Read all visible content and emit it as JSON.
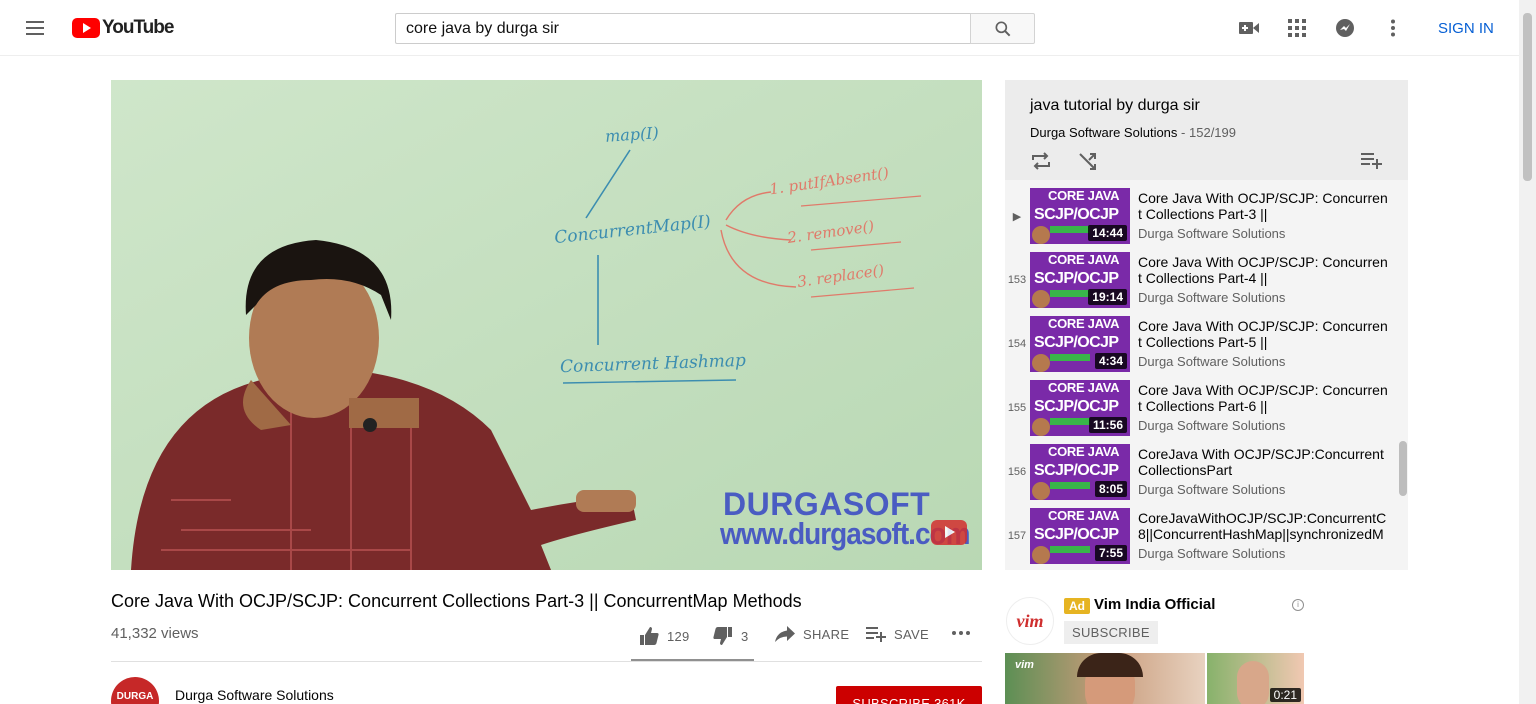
{
  "header": {
    "logo_text": "YouTube",
    "search_value": "core java by durga sir",
    "sign_in": "SIGN IN"
  },
  "video": {
    "title": "Core Java With OCJP/SCJP: Concurrent Collections Part-3 || ConcurrentMap Methods",
    "views": "41,332 views",
    "likes": "129",
    "dislikes": "3",
    "share": "SHARE",
    "save": "SAVE",
    "watermark_line1": "DURGASOFT",
    "watermark_line2": "www.durgasoft.com",
    "whiteboard": {
      "map": "map(I)",
      "concurrent_map": "ConcurrentMap(I)",
      "m1": "1. putIfAbsent()",
      "m2": "2. remove()",
      "m3": "3. replace()",
      "chm": "Concurrent Hashmap"
    }
  },
  "owner": {
    "name": "Durga Software Solutions",
    "subscribe": "SUBSCRIBE 361K"
  },
  "playlist": {
    "title": "java tutorial by durga sir",
    "owner": "Durga Software Solutions",
    "position": "152/199",
    "items": [
      {
        "index": "▶",
        "title": "Core Java With OCJP/SCJP: Concurrent Collections Part-3 ||",
        "channel": "Durga Software Solutions",
        "duration": "14:44"
      },
      {
        "index": "153",
        "title": "Core Java With OCJP/SCJP: Concurrent Collections Part-4 ||",
        "channel": "Durga Software Solutions",
        "duration": "19:14"
      },
      {
        "index": "154",
        "title": "Core Java With OCJP/SCJP: Concurrent Collections Part-5 ||",
        "channel": "Durga Software Solutions",
        "duration": "4:34"
      },
      {
        "index": "155",
        "title": "Core Java With OCJP/SCJP: Concurrent Collections Part-6 ||",
        "channel": "Durga Software Solutions",
        "duration": "11:56"
      },
      {
        "index": "156",
        "title": "CoreJava With OCJP/SCJP:ConcurrentCollectionsPart",
        "channel": "Durga Software Solutions",
        "duration": "8:05"
      },
      {
        "index": "157",
        "title": "CoreJavaWithOCJP/SCJP:ConcurrentC 8||ConcurrentHashMap||synchronizedM",
        "channel": "Durga Software Solutions",
        "duration": "7:55"
      }
    ],
    "thumb_line1": "CORE JAVA",
    "thumb_line2": "SCJP/OCJP"
  },
  "ad": {
    "badge": "Ad",
    "name": "Vim India Official",
    "subscribe": "SUBSCRIBE",
    "duration": "0:21",
    "logo_text": "vim"
  }
}
